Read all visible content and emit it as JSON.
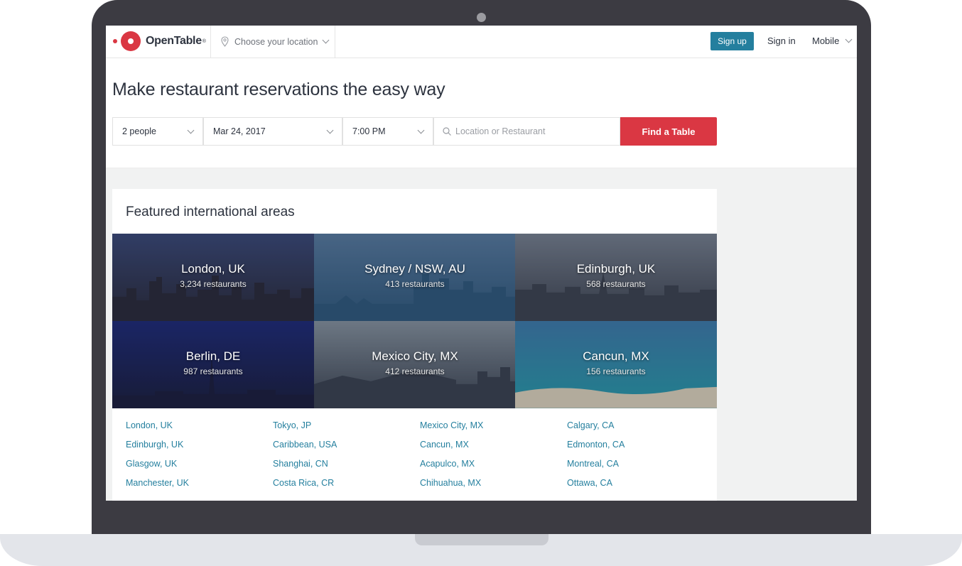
{
  "nav": {
    "brand": "OpenTable",
    "brand_mark": "®",
    "location_label": "Choose your location",
    "signup_label": "Sign up",
    "signin_label": "Sign in",
    "mobile_label": "Mobile"
  },
  "hero": {
    "title": "Make restaurant reservations the easy way"
  },
  "search": {
    "party_size": "2 people",
    "date": "Mar 24, 2017",
    "time": "7:00 PM",
    "query_placeholder": "Location or Restaurant",
    "find_label": "Find a Table"
  },
  "featured": {
    "title": "Featured international areas",
    "tiles": [
      {
        "name": "London, UK",
        "count": "3,234 restaurants",
        "sky": "#3b4a7a",
        "city": "#2a2a38"
      },
      {
        "name": "Sydney / NSW, AU",
        "count": "413 restaurants",
        "sky": "#5a7fa4",
        "city": "#2f5b7f"
      },
      {
        "name": "Edinburgh, UK",
        "count": "568 restaurants",
        "sky": "#7b8593",
        "city": "#3e4450"
      },
      {
        "name": "Berlin, DE",
        "count": "987 restaurants",
        "sky": "#1c2a7a",
        "city": "#1a1d3c"
      },
      {
        "name": "Mexico City, MX",
        "count": "412 restaurants",
        "sky": "#8b98a3",
        "city": "#3b4350"
      },
      {
        "name": "Cancun, MX",
        "count": "156 restaurants",
        "sky": "#3f7fb0",
        "city": "#27a3b0"
      }
    ]
  },
  "city_links": {
    "col1": [
      "London, UK",
      "Edinburgh, UK",
      "Glasgow, UK",
      "Manchester, UK"
    ],
    "col2": [
      "Tokyo, JP",
      "Caribbean, USA",
      "Shanghai, CN",
      "Costa Rica, CR"
    ],
    "col3": [
      "Mexico City, MX",
      "Cancun, MX",
      "Acapulco, MX",
      "Chihuahua, MX"
    ],
    "col4": [
      "Calgary, CA",
      "Edmonton, CA",
      "Montreal, CA",
      "Ottawa, CA"
    ]
  },
  "colors": {
    "brand_red": "#da3743",
    "link_blue": "#247f9e",
    "laptop_frame": "#3c3b42"
  }
}
